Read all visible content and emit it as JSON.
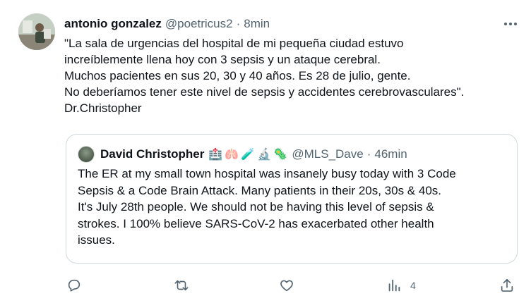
{
  "tweet": {
    "author_name": "antonio gonzalez",
    "author_handle": "@poetricus2",
    "separator": "·",
    "time": "8min",
    "text_lines": [
      "\"La sala de urgencias del hospital de mi pequeña ciudad estuvo",
      "increíblemente llena hoy con 3 sepsis y un ataque cerebral.",
      "Muchos pacientes en sus 20, 30 y 40 años. Es 28 de julio, gente.",
      "No deberíamos tener este nivel de sepsis y accidentes cerebrovasculares\".",
      "Dr.Christopher"
    ]
  },
  "quote": {
    "author_name": "David Christopher",
    "emojis": [
      "🏥",
      "🫁",
      "🧪",
      "🔬",
      "🦠"
    ],
    "author_handle": "@MLS_Dave",
    "separator": "·",
    "time": "46min",
    "text_lines": [
      "The ER at my small town hospital was insanely busy today with 3 Code",
      "Sepsis & a Code Brain Attack. Many patients in their 20s, 30s & 40s.",
      "It's July 28th people. We should not be having this level of sepsis &",
      "strokes. I 100% believe SARS-CoV-2 has exacerbated other health",
      "issues."
    ]
  },
  "actions": {
    "reply_icon": "reply-icon",
    "retweet_icon": "retweet-icon",
    "like_icon": "like-icon",
    "views_icon": "views-icon",
    "views_count": "4",
    "share_icon": "share-icon"
  },
  "colors": {
    "text": "#0f1419",
    "secondary": "#536471",
    "border": "#cfd9de"
  }
}
